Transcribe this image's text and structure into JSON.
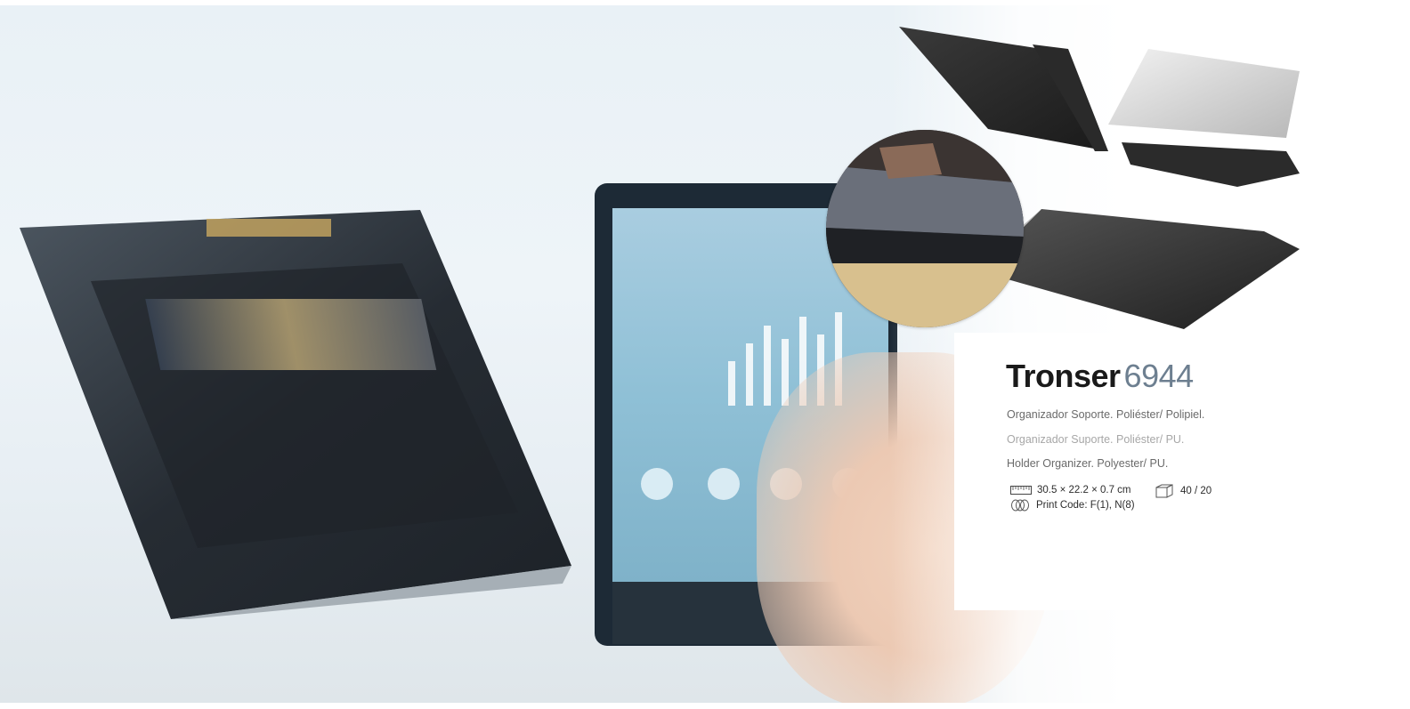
{
  "product": {
    "name": "Tronser",
    "code": "6944",
    "description_es": "Organizador Soporte. Poliéster/ Polipiel.",
    "description_pt": "Organizador Suporte. Poliéster/ PU.",
    "description_en": "Holder Organizer. Polyester/ PU.",
    "dimensions": "30.5 × 22.2 × 0.7 cm",
    "packaging": "40 / 20",
    "print_code": "Print Code: F(1), N(8)"
  },
  "icons": {
    "dimensions": "ruler-icon",
    "packaging": "box-icon",
    "print_code": "print-technique-icon"
  },
  "colors": {
    "name": "#1a1a1a",
    "code": "#6d7f90",
    "text": "#6a6a6a",
    "text_light": "#a7a7a7"
  }
}
